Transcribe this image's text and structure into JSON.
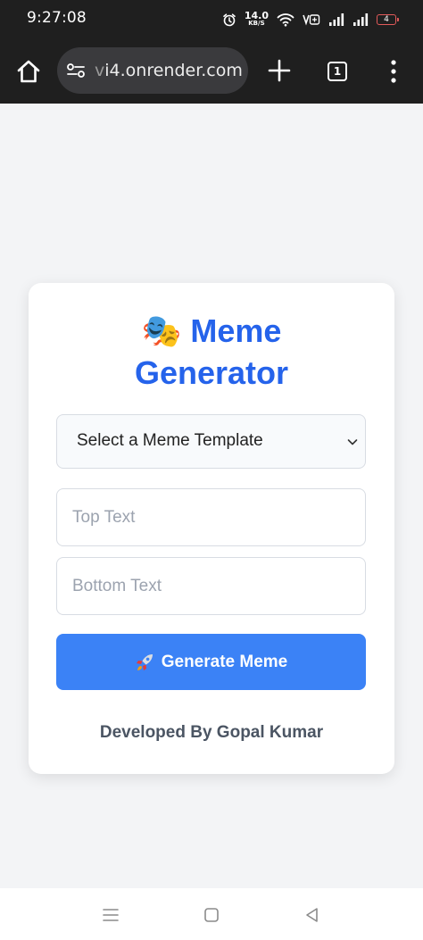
{
  "status_bar": {
    "time": "9:27:08",
    "net_speed_value": "14.0",
    "net_speed_unit": "KB/S",
    "battery_level": "4",
    "icons": [
      "alarm-icon",
      "wifi-icon",
      "volte-icon",
      "signal-icon",
      "signal-icon",
      "battery-icon"
    ]
  },
  "browser": {
    "url_faded": "v",
    "url_text": "i4.onrender.com",
    "tab_count": "1",
    "icons": [
      "home-icon",
      "site-settings-icon",
      "new-tab-icon",
      "tab-switcher-icon",
      "more-menu-icon"
    ]
  },
  "app": {
    "title_emoji": "🎭",
    "title_line1": "Meme",
    "title_line2": "Generator",
    "template_select": {
      "selected": "Select a Meme Template"
    },
    "top_text": {
      "value": "",
      "placeholder": "Top Text"
    },
    "bottom_text": {
      "value": "",
      "placeholder": "Bottom Text"
    },
    "generate_button": "Generate Meme",
    "credit": "Developed By Gopal Kumar"
  },
  "colors": {
    "title": "#2563eb",
    "button": "#3b82f6",
    "page_background": "#f3f4f6",
    "browser_chrome": "#1f1f1f"
  },
  "nav": {
    "icons": [
      "recent-apps-icon",
      "home-icon",
      "back-icon"
    ]
  }
}
